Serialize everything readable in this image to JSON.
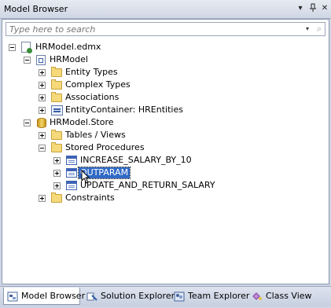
{
  "window": {
    "title": "Model Browser"
  },
  "titlebar_buttons": {
    "dropdown": "▾",
    "pin": "📌",
    "close": "✕"
  },
  "search": {
    "placeholder": "Type here to search",
    "dropdown_glyph": "▾",
    "go_glyph": "⌕"
  },
  "tree": {
    "root": "HRModel.edmx",
    "model": "HRModel",
    "entity_types": "Entity Types",
    "complex_types": "Complex Types",
    "associations": "Associations",
    "entity_container": "EntityContainer: HREntities",
    "store": "HRModel.Store",
    "tables_views": "Tables / Views",
    "stored_procedures": "Stored Procedures",
    "proc_1": "INCREASE_SALARY_BY_10",
    "proc_2": "OUTPARAM",
    "proc_3": "UPDATE_AND_RETURN_SALARY",
    "constraints": "Constraints"
  },
  "bottom_tabs": [
    {
      "label": "Model Browser",
      "active": true
    },
    {
      "label": "Solution Explorer",
      "active": false
    },
    {
      "label": "Team Explorer",
      "active": false
    },
    {
      "label": "Class View",
      "active": false
    }
  ],
  "colors": {
    "selection": "#316ac5",
    "folder": "#f5d97a"
  }
}
